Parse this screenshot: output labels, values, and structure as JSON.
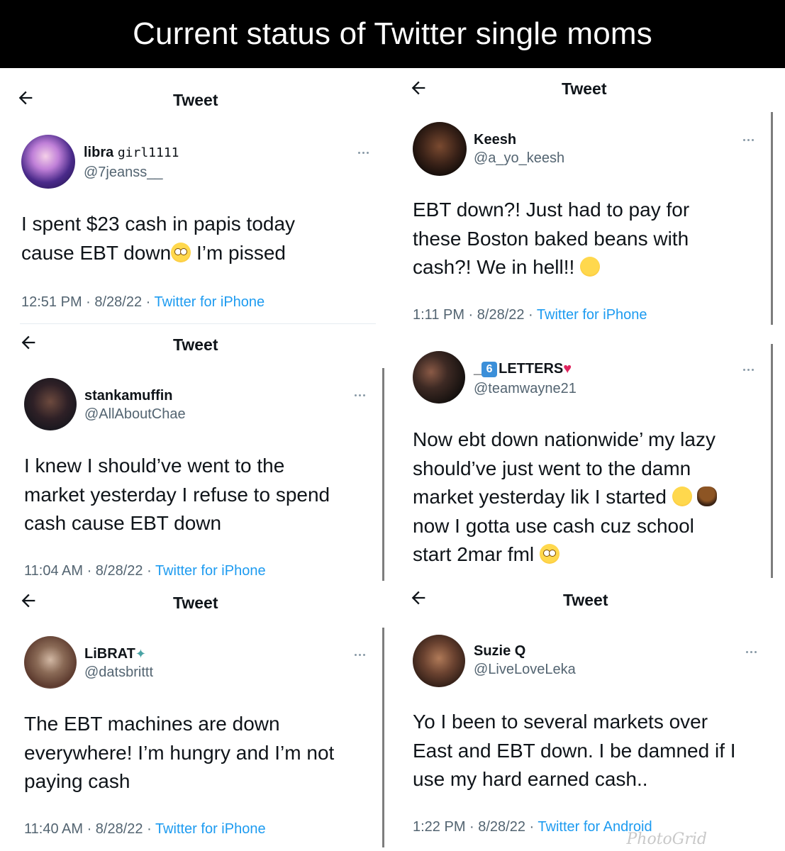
{
  "banner": {
    "title": "Current status of Twitter single moms"
  },
  "tweets": [
    {
      "header": "Tweet",
      "name": "libra girl111",
      "name_bold": "libra",
      "name_mono": "girl1111",
      "handle": "@7jeanss__",
      "lines": [
        "I spent $23 cash in papis today",
        "cause EBT down",
        " I’m pissed"
      ],
      "time": "12:51 PM · 8/28/22 · ",
      "source": "Twitter for iPhone"
    },
    {
      "header": "Tweet",
      "name": "Keesh",
      "handle": "@a_yo_keesh",
      "lines": [
        "EBT down?! Just had to pay for",
        "these Boston baked beans with",
        "cash?! We in hell!! "
      ],
      "time": "1:11 PM · 8/28/22 · ",
      "source": "Twitter for iPhone"
    },
    {
      "header": "Tweet",
      "name": "stankamuffin",
      "handle": "@AllAboutChae",
      "lines": [
        "I knew I should’ve went to the",
        "market yesterday I refuse to spend",
        "cash cause EBT down"
      ],
      "time": "11:04 AM · 8/28/22 · ",
      "source": "Twitter for iPhone"
    },
    {
      "name_prefix": "_",
      "name_badge": "6",
      "name": "LETTERS",
      "handle": "@teamwayne21",
      "lines": [
        "Now ebt down nationwide’ my lazy",
        "should’ve just went to the damn",
        "market yesterday lik I started ",
        "now I gotta use cash cuz school",
        "start 2mar fml "
      ]
    },
    {
      "header": "Tweet",
      "name": "LiBRAT",
      "handle": "@datsbrittt",
      "lines": [
        "The EBT machines are down",
        "everywhere! I’m hungry and I’m not",
        "paying cash"
      ],
      "time": "11:40 AM · 8/28/22 · ",
      "source": "Twitter for iPhone"
    },
    {
      "header": "Tweet",
      "name": "Suzie Q",
      "handle": "@LiveLoveLeka",
      "lines": [
        "Yo I been to several markets over",
        "East and EBT down. I be damned if I",
        "use my hard earned cash.."
      ],
      "time": "1:22 PM · 8/28/22 · ",
      "source": "Twitter for Android"
    }
  ],
  "watermark": "PhotoGrid",
  "colors": {
    "link": "#1d9bf0",
    "muted": "#536471",
    "banner_bg": "#000000"
  },
  "icons": {
    "back": "arrow-left-icon",
    "more": "more-dots-icon"
  }
}
